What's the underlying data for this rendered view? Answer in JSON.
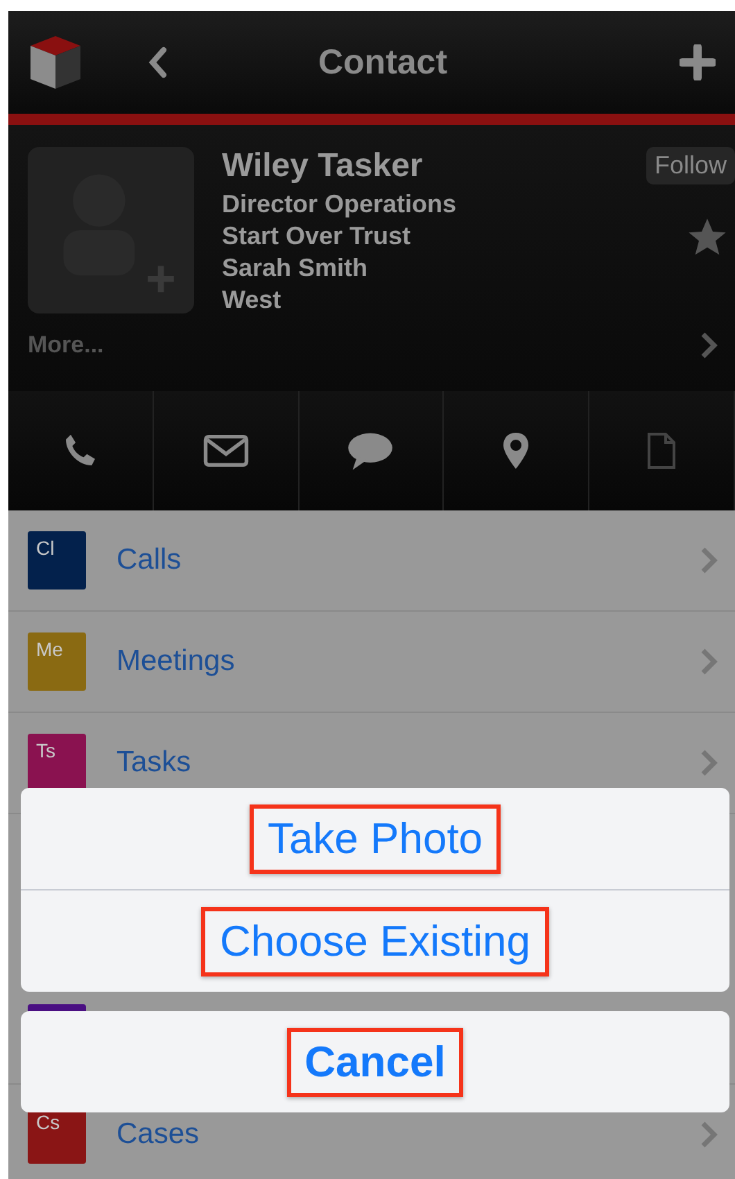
{
  "nav_bar": {
    "title": "Contact"
  },
  "profile": {
    "name": "Wiley Tasker",
    "details": [
      "Director Operations",
      "Start Over Trust",
      "Sarah Smith",
      "West"
    ],
    "follow_button": "Follow",
    "starred": false,
    "more": "More..."
  },
  "actions": [
    {
      "kind": "phone"
    },
    {
      "kind": "email"
    },
    {
      "kind": "message"
    },
    {
      "kind": "location"
    },
    {
      "kind": "document",
      "disabled": true
    }
  ],
  "list": [
    {
      "abbr": "Cl",
      "label": "Calls",
      "color": "#03214c"
    },
    {
      "abbr": "Me",
      "label": "Meetings",
      "color": "#8a6a12"
    },
    {
      "abbr": "Ts",
      "label": "Tasks",
      "color": "#8a1250"
    },
    {
      "color": "#4a0f82"
    },
    {
      "abbr": "Cs",
      "label": "Cases",
      "color": "#8a1515"
    }
  ],
  "action_sheet": {
    "options": [
      {
        "label": "Take Photo",
        "highlighted": true
      },
      {
        "label": "Choose Existing",
        "highlighted": true
      }
    ],
    "cancel": {
      "label": "Cancel",
      "highlighted": true
    }
  }
}
